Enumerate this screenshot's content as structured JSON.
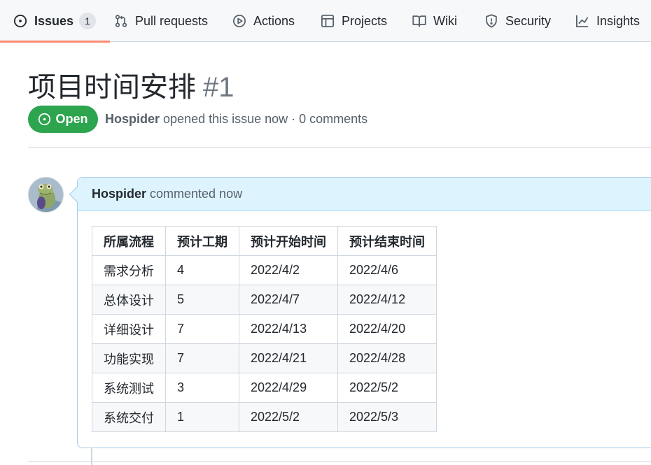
{
  "tabs": [
    {
      "label": "Issues",
      "icon": "issue-opened-icon",
      "counter": "1",
      "selected": true
    },
    {
      "label": "Pull requests",
      "icon": "git-pull-request-icon"
    },
    {
      "label": "Actions",
      "icon": "play-icon"
    },
    {
      "label": "Projects",
      "icon": "table-icon"
    },
    {
      "label": "Wiki",
      "icon": "book-icon"
    },
    {
      "label": "Security",
      "icon": "shield-icon"
    },
    {
      "label": "Insights",
      "icon": "graph-icon"
    }
  ],
  "issue": {
    "title": "项目时间安排",
    "number": "#1",
    "state": "Open",
    "author": "Hospider",
    "meta_text": "opened this issue now · 0 comments"
  },
  "comment": {
    "author": "Hospider",
    "action": "commented now"
  },
  "table": {
    "headers": [
      "所属流程",
      "预计工期",
      "预计开始时间",
      "预计结束时间"
    ],
    "rows": [
      [
        "需求分析",
        "4",
        "2022/4/2",
        "2022/4/6"
      ],
      [
        "总体设计",
        "5",
        "2022/4/7",
        "2022/4/12"
      ],
      [
        "详细设计",
        "7",
        "2022/4/13",
        "2022/4/20"
      ],
      [
        "功能实现",
        "7",
        "2022/4/21",
        "2022/4/28"
      ],
      [
        "系统测试",
        "3",
        "2022/4/29",
        "2022/5/2"
      ],
      [
        "系统交付",
        "1",
        "2022/5/2",
        "2022/5/3"
      ]
    ]
  },
  "colors": {
    "open_green": "#2da44e",
    "tab_underline": "#fd8c73",
    "comment_header_bg": "#ddf4ff"
  }
}
